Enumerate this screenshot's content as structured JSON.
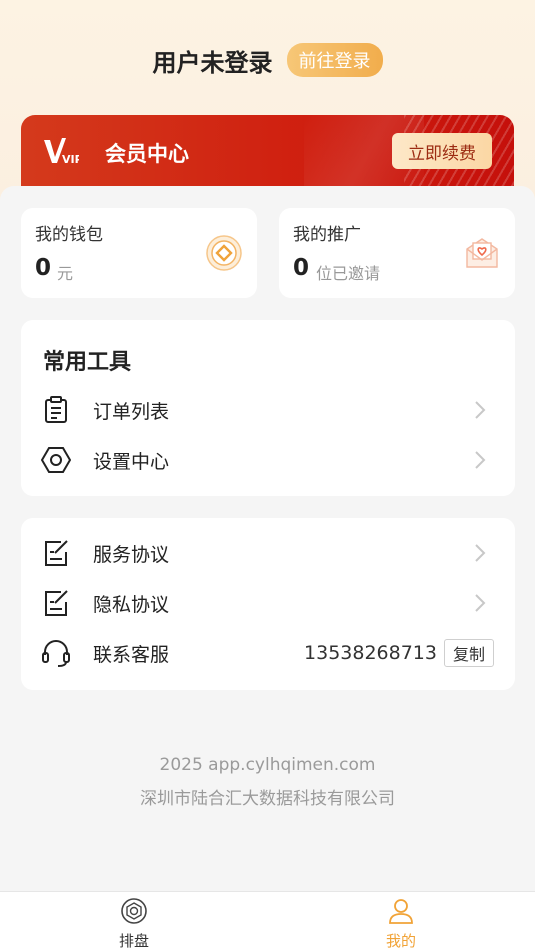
{
  "header": {
    "user_status": "用户未登录",
    "login_button": "前往登录"
  },
  "vip": {
    "logo_text": "VIP",
    "title": "会员中心",
    "renew_button": "立即续费"
  },
  "wallet": {
    "label": "我的钱包",
    "value": "0",
    "unit": "元"
  },
  "promotion": {
    "label": "我的推广",
    "value": "0",
    "unit": "位已邀请"
  },
  "tools": {
    "title": "常用工具",
    "items": [
      {
        "label": "订单列表",
        "icon": "clipboard-icon"
      },
      {
        "label": "设置中心",
        "icon": "hexagon-settings-icon"
      }
    ]
  },
  "service": {
    "items": [
      {
        "label": "服务协议",
        "icon": "document-edit-icon"
      },
      {
        "label": "隐私协议",
        "icon": "document-edit-icon"
      },
      {
        "label": "联系客服",
        "icon": "headset-icon"
      }
    ],
    "phone": "13538268713",
    "copy_button": "复制"
  },
  "footer": {
    "line1": "2025 app.cylhqimen.com",
    "line2": "深圳市陆合汇大数据科技有限公司"
  },
  "tabbar": {
    "tabs": [
      {
        "label": "排盘",
        "icon": "compass-icon",
        "active": false
      },
      {
        "label": "我的",
        "icon": "person-icon",
        "active": true
      }
    ],
    "active_color": "#f1a337",
    "inactive_color": "#333333"
  },
  "colors": {
    "accent": "#f1ad4c",
    "vip_red": "#cf1e0f"
  }
}
